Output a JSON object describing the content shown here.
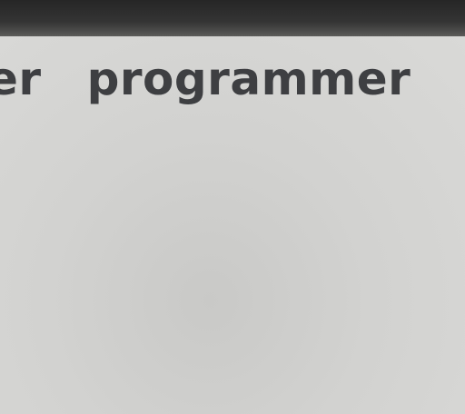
{
  "heading": {
    "left_word": "er",
    "right_word": "programmer"
  }
}
